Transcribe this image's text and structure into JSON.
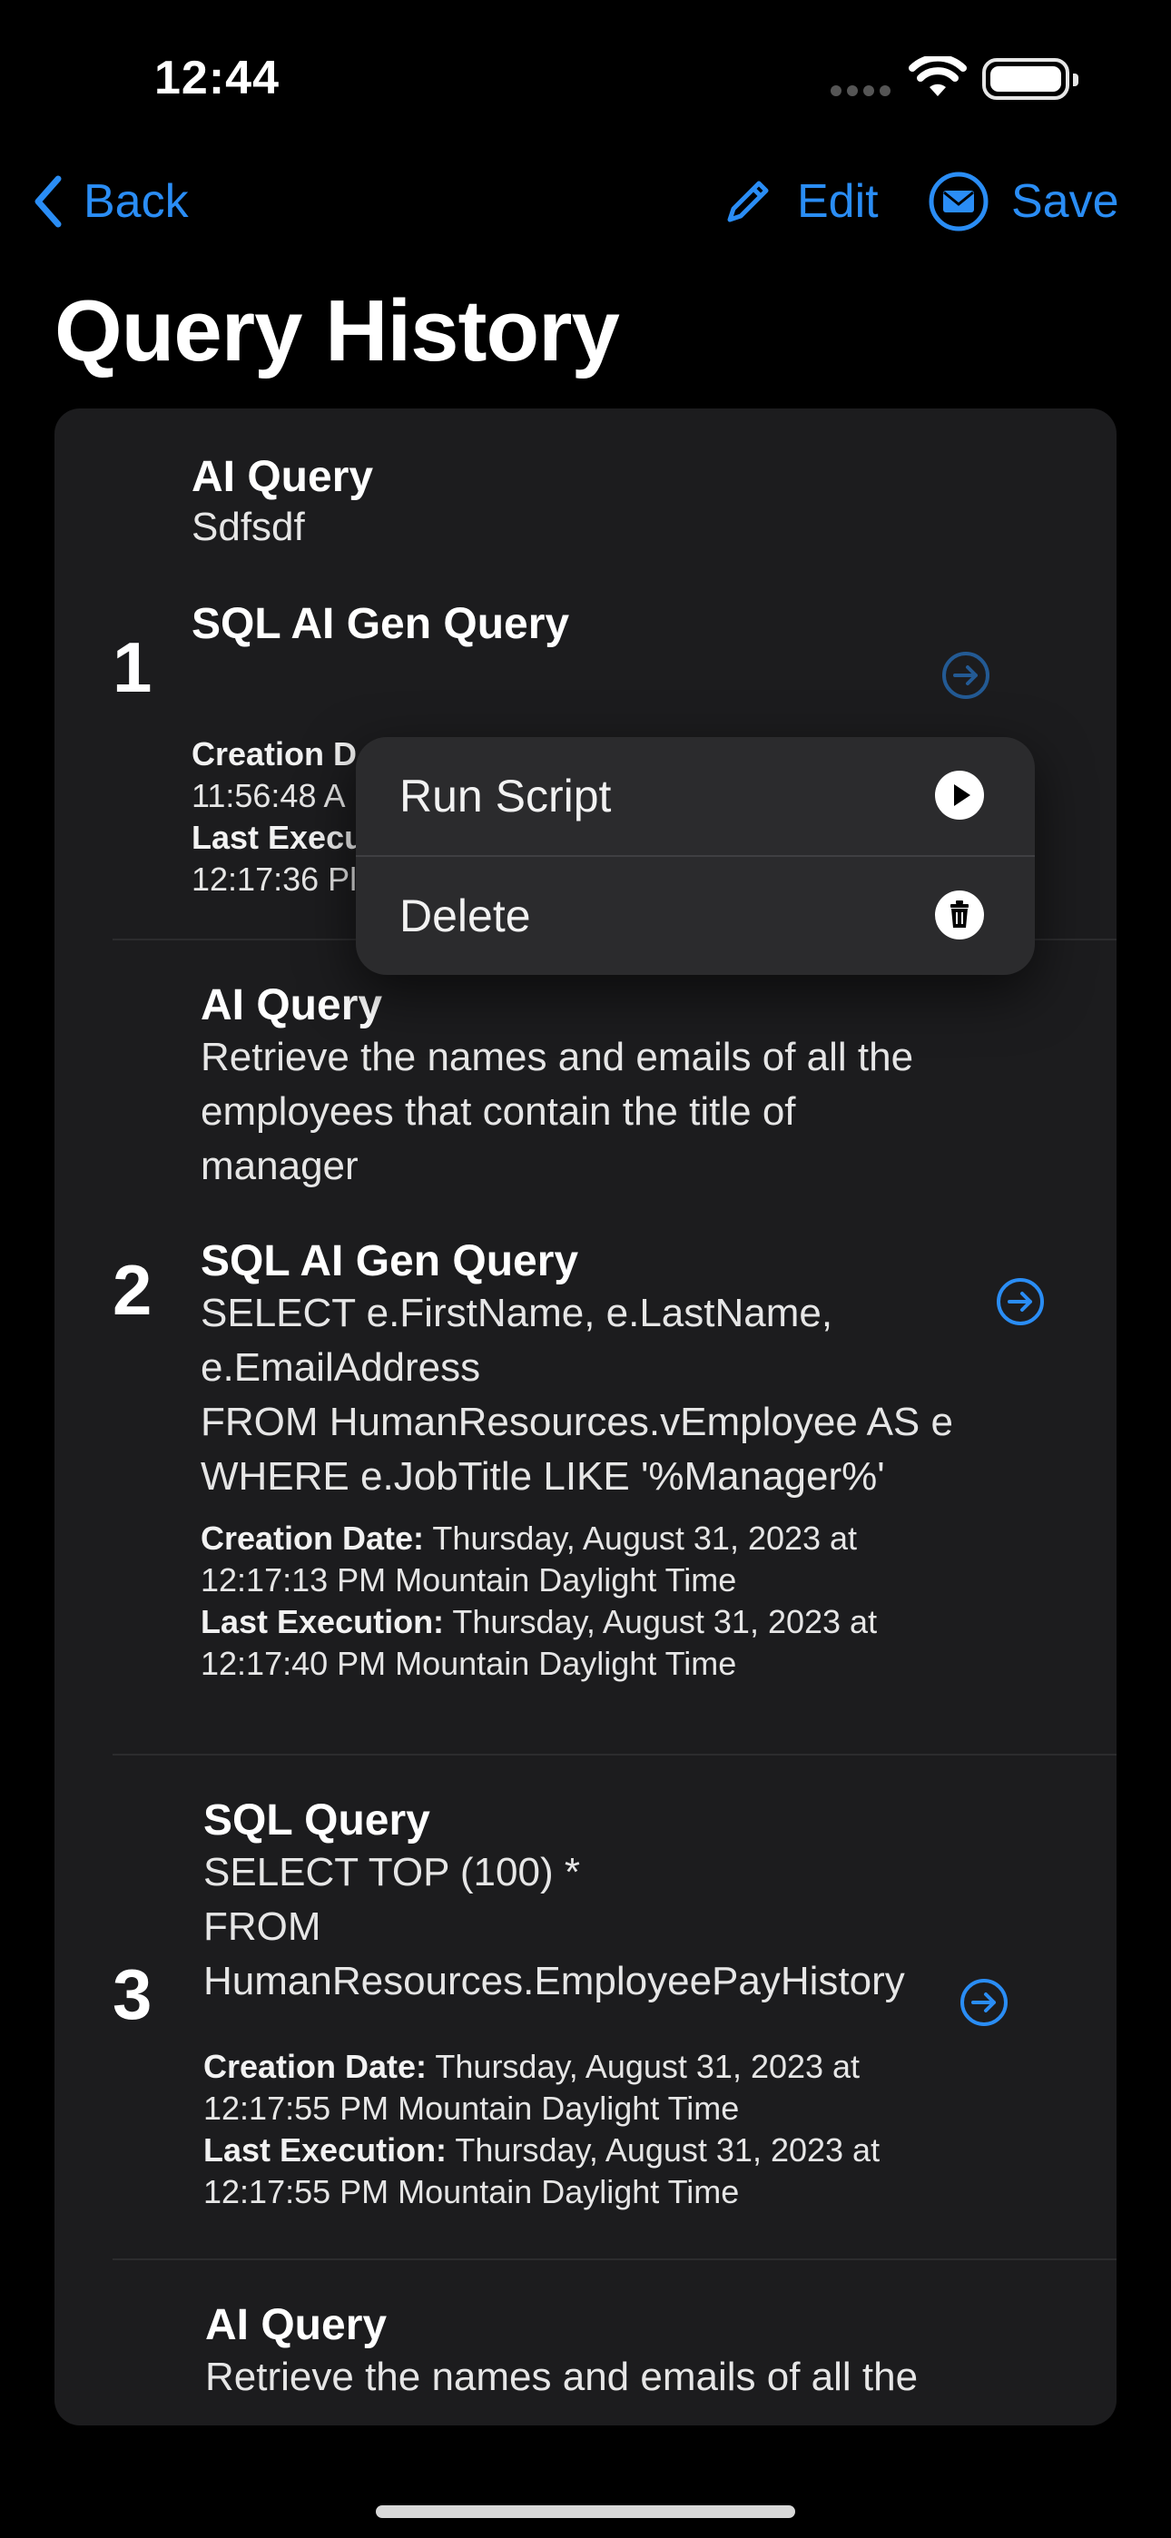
{
  "status": {
    "time": "12:44"
  },
  "nav": {
    "back_label": "Back",
    "edit_label": "Edit",
    "save_label": "Save"
  },
  "page": {
    "title": "Query History"
  },
  "items": [
    {
      "number": "1",
      "ai_title": "AI Query",
      "ai_text": "Sdfsdf",
      "sql_title": "SQL AI Gen Query",
      "creation_label": "Creation D",
      "creation_value": "11:56:48 A",
      "last_label": "Last Execu",
      "last_value": "12:17:36 Pl"
    },
    {
      "number": "2",
      "ai_title": "AI Query",
      "ai_lines": [
        "Retrieve the names and emails of all the",
        "employees that contain the title of",
        "manager"
      ],
      "sql_title": "SQL AI Gen Query",
      "sql_lines": [
        "SELECT e.FirstName, e.LastName,",
        "e.EmailAddress",
        "FROM HumanResources.vEmployee AS e",
        "WHERE e.JobTitle LIKE '%Manager%'"
      ],
      "creation_label": "Creation Date:",
      "creation_value": "Thursday, August 31, 2023 at",
      "creation_value2": "12:17:13 PM Mountain Daylight Time",
      "last_label": "Last Execution:",
      "last_value": "Thursday, August 31, 2023 at",
      "last_value2": "12:17:40 PM Mountain Daylight Time"
    },
    {
      "number": "3",
      "sql_title": "SQL Query",
      "sql_lines": [
        "SELECT TOP (100) *",
        "FROM",
        "HumanResources.EmployeePayHistory"
      ],
      "creation_label": "Creation Date:",
      "creation_value": "Thursday, August 31, 2023 at",
      "creation_value2": "12:17:55 PM Mountain Daylight Time",
      "last_label": "Last Execution:",
      "last_value": "Thursday, August 31, 2023 at",
      "last_value2": "12:17:55 PM Mountain Daylight Time"
    },
    {
      "ai_title": "AI Query",
      "ai_lines": [
        "Retrieve the names and emails of all the"
      ]
    }
  ],
  "context_menu": {
    "run_label": "Run Script",
    "delete_label": "Delete"
  },
  "icons": {
    "accent": "#2a8df5",
    "run": "play-circle-icon",
    "delete": "trash-icon",
    "edit": "pencil-icon",
    "save": "envelope-circle-icon",
    "row_action": "arrow-right-circle-icon"
  }
}
